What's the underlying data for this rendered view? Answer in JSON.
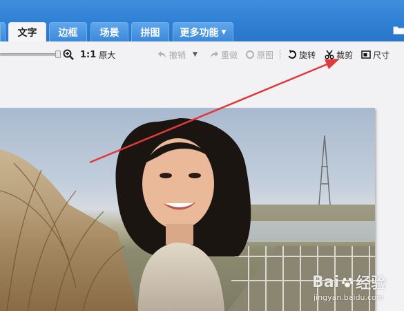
{
  "tabs": [
    {
      "label": "",
      "active": false
    },
    {
      "label": "文字",
      "active": true
    },
    {
      "label": "边框",
      "active": false
    },
    {
      "label": "场景",
      "active": false
    },
    {
      "label": "拼图",
      "active": false
    },
    {
      "label": "更多功能",
      "active": false
    }
  ],
  "toolbar": {
    "zoom_level": 1.0,
    "ratio_label": "1:1",
    "original_size_label": "原大",
    "undo_label": "撤销",
    "redo_label": "重做",
    "original_label": "原图",
    "rotate_label": "旋转",
    "crop_label": "裁剪",
    "size_label": "尺寸"
  },
  "icons": {
    "zoom": "zoom-in-icon",
    "undo": "undo-icon",
    "redo": "redo-icon",
    "original": "circle-icon",
    "rotate": "rotate-icon",
    "crop": "scissors-icon",
    "size": "resize-icon",
    "folder": "folder-icon"
  },
  "watermark": {
    "brand_left": "Bai",
    "brand_right": "经验",
    "url": "jingyan.baidu.com"
  },
  "colors": {
    "topbar": "#2f7fd4",
    "annotation_arrow": "#e0393b",
    "background": "#f2f1f4"
  }
}
